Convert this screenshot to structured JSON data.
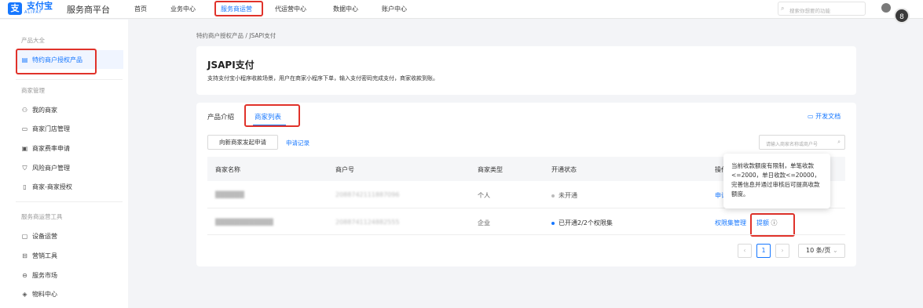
{
  "header": {
    "logo_cn": "支付宝",
    "logo_en": "ALIPAY",
    "platform": "服务商平台",
    "nav": [
      "首页",
      "业务中心",
      "服务商运营",
      "代运营中心",
      "数据中心",
      "账户中心"
    ],
    "search_placeholder": "搜索你想要的功能",
    "avatar_text": "8"
  },
  "sidebar": {
    "sections": [
      {
        "title": "产品大全",
        "items": [
          {
            "label": "特约商户授权产品",
            "icon": "grid-icon"
          }
        ]
      },
      {
        "title": "商家管理",
        "items": [
          {
            "label": "我的商家",
            "icon": "users-icon"
          },
          {
            "label": "商家门店管理",
            "icon": "store-icon"
          },
          {
            "label": "商家费率申请",
            "icon": "rate-icon"
          },
          {
            "label": "风险商户管理",
            "icon": "shield-icon"
          },
          {
            "label": "商家-商家授权",
            "icon": "auth-icon"
          }
        ]
      },
      {
        "title": "服务商运营工具",
        "items": [
          {
            "label": "设备运营",
            "icon": "device-icon"
          },
          {
            "label": "营销工具",
            "icon": "gift-icon"
          },
          {
            "label": "服务市场",
            "icon": "market-icon"
          },
          {
            "label": "物料中心",
            "icon": "layers-icon"
          }
        ]
      }
    ]
  },
  "breadcrumb": "特约商户授权产品 / JSAPI支付",
  "product": {
    "title": "JSAPI支付",
    "description": "支持支付宝小程序收款场景，用户在商家小程序下单，输入支付密码完成支付，商家收款到账。"
  },
  "tabs": [
    "产品介绍",
    "商家列表"
  ],
  "dev_doc": "开发文档",
  "toolbar": {
    "apply_button": "向新商家发起申请",
    "records_link": "申请记录",
    "search_placeholder": "请输入商家名称或商户号"
  },
  "table": {
    "headers": [
      "商家名称",
      "商户号",
      "商家类型",
      "开通状态",
      "操作"
    ],
    "rows": [
      {
        "name": "██████",
        "mid": "2088742111887096",
        "type": "个人",
        "status": "未开通",
        "status_color": "#bbbbbb",
        "ops": [
          "申请开通"
        ]
      },
      {
        "name": "████████████",
        "mid": "2088741124882555",
        "type": "企业",
        "status": "已开通2/2个权限集",
        "status_color": "#1677ff",
        "ops": [
          "权限集管理",
          "提额"
        ]
      }
    ]
  },
  "tooltip": "当前收款额度有限制，单笔收款<=2000，单日收款<=20000，完善信息并通过审核后可提高收款额度。",
  "pagination": {
    "current": "1",
    "page_size": "10 条/页"
  }
}
